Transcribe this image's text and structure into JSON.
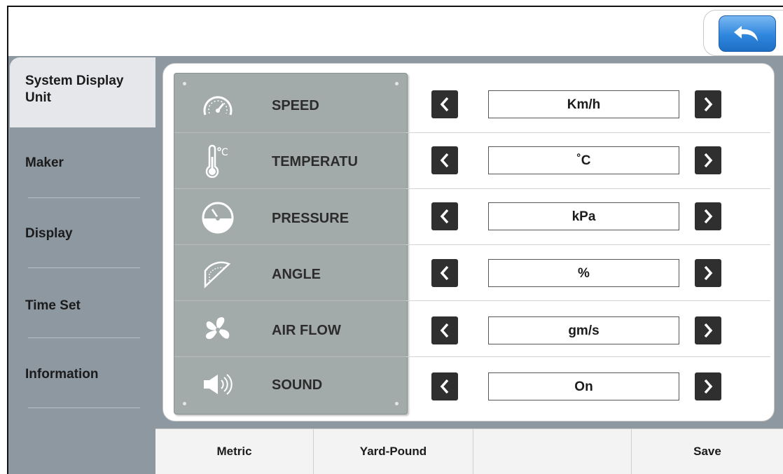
{
  "header": {
    "back_icon": "back-arrow-icon",
    "back_color": "#2f86dd"
  },
  "sidebar": {
    "items": [
      {
        "label": "System Display\nUnit",
        "active": true
      },
      {
        "label": "Maker",
        "active": false
      },
      {
        "label": "Display",
        "active": false
      },
      {
        "label": "Time Set",
        "active": false
      },
      {
        "label": "Information",
        "active": false
      }
    ]
  },
  "units": [
    {
      "label": "SPEED",
      "icon": "speedometer-icon",
      "value": "Km/h"
    },
    {
      "label": "TEMPERATU",
      "icon": "thermometer-icon",
      "value": "˚C"
    },
    {
      "label": "PRESSURE",
      "icon": "pressure-gauge-icon",
      "value": "kPa"
    },
    {
      "label": "ANGLE",
      "icon": "protractor-icon",
      "value": "%"
    },
    {
      "label": "AIR FLOW",
      "icon": "fan-icon",
      "value": "gm/s"
    },
    {
      "label": "SOUND",
      "icon": "speaker-icon",
      "value": "On"
    }
  ],
  "bottom_bar": {
    "buttons": [
      {
        "label": "Metric"
      },
      {
        "label": "Yard-Pound"
      },
      {
        "label": ""
      },
      {
        "label": "Save"
      }
    ]
  },
  "colors": {
    "sidebar": "#8e98a1",
    "plate": "#a3abaa",
    "arrow_button": "#2f2f2f"
  }
}
